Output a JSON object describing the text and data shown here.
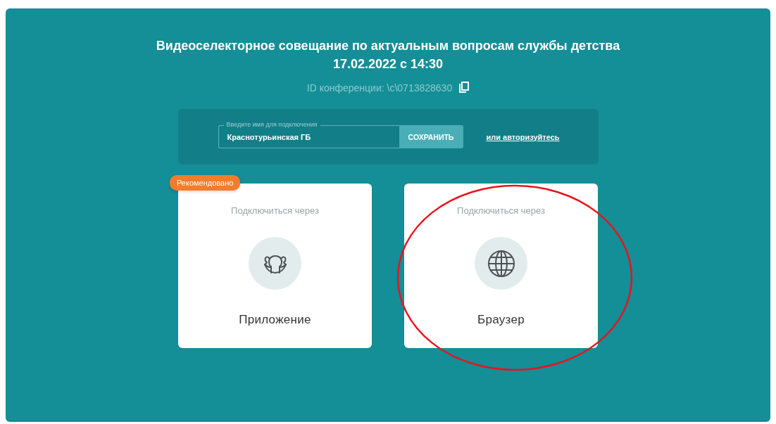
{
  "header": {
    "title": "Видеоселекторное совещание по актуальным вопросам службы детства",
    "date": "17.02.2022 с 14:30",
    "conference_id": "ID конференции: \\c\\0713828630"
  },
  "join_form": {
    "name_field": {
      "label": "Введите имя для подключения",
      "value": "Краснотурьинская ГБ"
    },
    "save_button": "СОХРАНИТЬ",
    "login_link": "или авторизуйтесь"
  },
  "options": [
    {
      "kind": "app",
      "caption": "Подключиться через",
      "title": "Приложение",
      "badge": "Рекомендовано"
    },
    {
      "kind": "browser",
      "caption": "Подключиться через",
      "title": "Браузер"
    }
  ],
  "annotations": [
    {
      "kind": "ellipse"
    }
  ]
}
